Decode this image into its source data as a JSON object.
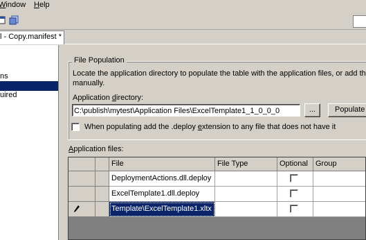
{
  "menubar": {
    "items": [
      {
        "label_pre": "",
        "mnemonic": "W",
        "label_post": "indow"
      },
      {
        "label_pre": "",
        "mnemonic": "H",
        "label_post": "elp"
      }
    ]
  },
  "toolbar": {
    "icons": [
      "window-icon",
      "pages-icon"
    ]
  },
  "document_tab": {
    "label": "l - Copy.manifest *"
  },
  "nav": {
    "items": [
      {
        "label": "ns",
        "selected": false
      },
      {
        "label": "",
        "selected": true
      },
      {
        "label": "uired",
        "selected": false
      }
    ]
  },
  "file_population": {
    "title": "File Population",
    "description_line1": "Locate the application directory to populate the table with the application files, or add them",
    "description_line2": "manually.",
    "app_dir_label_pre": "Application ",
    "app_dir_label_mnemonic": "d",
    "app_dir_label_post": "irectory:",
    "app_dir_value": "C:\\publish\\mytest\\Application Files\\ExcelTemplate1_1_0_0_0",
    "browse_label": "...",
    "populate_label": "Populate",
    "deploy_checkbox_label_pre": "When populating add the .deploy ",
    "deploy_checkbox_label_mnemonic": "e",
    "deploy_checkbox_label_post": "xtension to any file that does not have it",
    "deploy_checked": false
  },
  "application_files": {
    "label_pre": "",
    "label_mnemonic": "A",
    "label_post": "pplication files:",
    "columns": [
      "File",
      "File Type",
      "Optional",
      "Group"
    ],
    "rows": [
      {
        "file": "DeploymentActions.dll.deploy",
        "file_type": "",
        "optional": false,
        "group": "",
        "selected": false,
        "editing": false
      },
      {
        "file": "ExcelTemplate1.dll.deploy",
        "file_type": "",
        "optional": false,
        "group": "",
        "selected": false,
        "editing": false
      },
      {
        "file": "Template\\ExcelTemplate1.xltx",
        "file_type": "",
        "optional": false,
        "group": "",
        "selected": true,
        "editing": true
      }
    ]
  },
  "colors": {
    "selection": "#0a246a",
    "face": "#d4d0c8"
  }
}
